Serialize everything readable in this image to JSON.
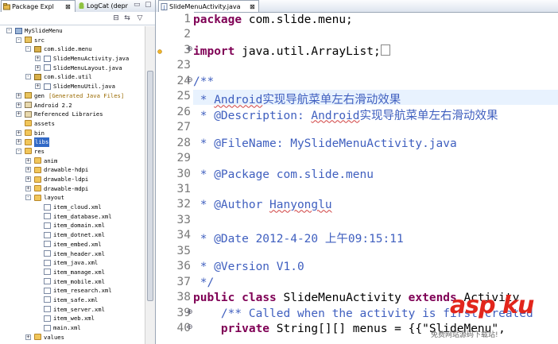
{
  "left_panel": {
    "tabs": [
      {
        "label": "Package Expl",
        "icon": "package-explorer-icon"
      },
      {
        "label": "LogCat (depr",
        "icon": "android-icon"
      }
    ],
    "tree": [
      {
        "label": "MySlideMenu",
        "depth": 0,
        "expander": "-",
        "icon": "project"
      },
      {
        "label": "src",
        "depth": 1,
        "expander": "-",
        "icon": "pkgfolder"
      },
      {
        "label": "com.slide.menu",
        "depth": 2,
        "expander": "-",
        "icon": "package"
      },
      {
        "label": "SlideMenuActivity.java",
        "depth": 3,
        "expander": "+",
        "icon": "javafile"
      },
      {
        "label": "SlideMenuLayout.java",
        "depth": 3,
        "expander": "+",
        "icon": "javafile"
      },
      {
        "label": "com.slide.util",
        "depth": 2,
        "expander": "-",
        "icon": "package"
      },
      {
        "label": "SlideMenuUtil.java",
        "depth": 3,
        "expander": "+",
        "icon": "javafile"
      },
      {
        "label": "gen",
        "suffix": "[Generated Java Files]",
        "depth": 1,
        "expander": "+",
        "icon": "pkgfolder"
      },
      {
        "label": "Android 2.2",
        "depth": 1,
        "expander": "+",
        "icon": "libfolder"
      },
      {
        "label": "Referenced Libraries",
        "depth": 1,
        "expander": "+",
        "icon": "libfolder"
      },
      {
        "label": "assets",
        "depth": 1,
        "expander": "",
        "icon": "folder"
      },
      {
        "label": "bin",
        "depth": 1,
        "expander": "+",
        "icon": "folder"
      },
      {
        "label": "libs",
        "depth": 1,
        "expander": "+",
        "icon": "folder",
        "selected": true
      },
      {
        "label": "res",
        "depth": 1,
        "expander": "-",
        "icon": "folder"
      },
      {
        "label": "anim",
        "depth": 2,
        "expander": "+",
        "icon": "folder"
      },
      {
        "label": "drawable-hdpi",
        "depth": 2,
        "expander": "+",
        "icon": "folder"
      },
      {
        "label": "drawable-ldpi",
        "depth": 2,
        "expander": "+",
        "icon": "folder"
      },
      {
        "label": "drawable-mdpi",
        "depth": 2,
        "expander": "+",
        "icon": "folder"
      },
      {
        "label": "layout",
        "depth": 2,
        "expander": "-",
        "icon": "folder"
      },
      {
        "label": "item_cloud.xml",
        "depth": 3,
        "expander": "",
        "icon": "xmlfile"
      },
      {
        "label": "item_database.xml",
        "depth": 3,
        "expander": "",
        "icon": "xmlfile"
      },
      {
        "label": "item_domain.xml",
        "depth": 3,
        "expander": "",
        "icon": "xmlfile"
      },
      {
        "label": "item_dotnet.xml",
        "depth": 3,
        "expander": "",
        "icon": "xmlfile"
      },
      {
        "label": "item_embed.xml",
        "depth": 3,
        "expander": "",
        "icon": "xmlfile"
      },
      {
        "label": "item_header.xml",
        "depth": 3,
        "expander": "",
        "icon": "xmlfile"
      },
      {
        "label": "item_java.xml",
        "depth": 3,
        "expander": "",
        "icon": "xmlfile"
      },
      {
        "label": "item_manage.xml",
        "depth": 3,
        "expander": "",
        "icon": "xmlfile"
      },
      {
        "label": "item_mobile.xml",
        "depth": 3,
        "expander": "",
        "icon": "xmlfile"
      },
      {
        "label": "item_research.xml",
        "depth": 3,
        "expander": "",
        "icon": "xmlfile"
      },
      {
        "label": "item_safe.xml",
        "depth": 3,
        "expander": "",
        "icon": "xmlfile"
      },
      {
        "label": "item_server.xml",
        "depth": 3,
        "expander": "",
        "icon": "xmlfile"
      },
      {
        "label": "item_web.xml",
        "depth": 3,
        "expander": "",
        "icon": "xmlfile"
      },
      {
        "label": "main.xml",
        "depth": 3,
        "expander": "",
        "icon": "xmlfile"
      },
      {
        "label": "values",
        "depth": 2,
        "expander": "+",
        "icon": "folder"
      }
    ]
  },
  "editor": {
    "tab_label": "SlideMenuActivity.java",
    "tab_close": "⊠",
    "highlight_line": 25,
    "lines": [
      {
        "no": "1",
        "segments": [
          {
            "t": "package",
            "c": "kw"
          },
          {
            "t": " com.slide.menu;"
          }
        ]
      },
      {
        "no": "2",
        "segments": []
      },
      {
        "no": "3",
        "fold": "+",
        "marker": true,
        "segments": [
          {
            "t": "import",
            "c": "kw"
          },
          {
            "t": " java.util.ArrayList;"
          },
          {
            "t": "",
            "c": "foldbox"
          }
        ]
      },
      {
        "no": "23",
        "segments": []
      },
      {
        "no": "24",
        "fold": "-",
        "segments": [
          {
            "t": "/**",
            "c": "cm"
          }
        ]
      },
      {
        "no": "25",
        "segments": [
          {
            "t": " * ",
            "c": "cm"
          },
          {
            "t": "Android",
            "c": "cm squig"
          },
          {
            "t": "实现导航菜单左右滑动效果",
            "c": "cm cjk"
          }
        ]
      },
      {
        "no": "26",
        "segments": [
          {
            "t": " * @Description: ",
            "c": "cm"
          },
          {
            "t": "Android",
            "c": "cm squig"
          },
          {
            "t": "实现导航菜单左右滑动效果",
            "c": "cm cjk"
          }
        ]
      },
      {
        "no": "27",
        "segments": []
      },
      {
        "no": "28",
        "segments": [
          {
            "t": " * @FileName: MySlideMenuActivity.java",
            "c": "cm"
          }
        ]
      },
      {
        "no": "29",
        "segments": []
      },
      {
        "no": "30",
        "segments": [
          {
            "t": " * @Package com.slide.menu",
            "c": "cm"
          }
        ]
      },
      {
        "no": "31",
        "segments": []
      },
      {
        "no": "32",
        "segments": [
          {
            "t": " * @Author ",
            "c": "cm"
          },
          {
            "t": "Hanyonglu",
            "c": "cm squig"
          }
        ]
      },
      {
        "no": "33",
        "segments": []
      },
      {
        "no": "34",
        "segments": [
          {
            "t": " * @Date 2012-4-20 ",
            "c": "cm"
          },
          {
            "t": "上午",
            "c": "cm cjk"
          },
          {
            "t": "09:15:11",
            "c": "cm"
          }
        ]
      },
      {
        "no": "35",
        "segments": []
      },
      {
        "no": "36",
        "segments": [
          {
            "t": " * @Version V1.0",
            "c": "cm"
          }
        ]
      },
      {
        "no": "37",
        "segments": [
          {
            "t": " */",
            "c": "cm"
          }
        ]
      },
      {
        "no": "38",
        "segments": [
          {
            "t": "public",
            "c": "kw"
          },
          {
            "t": " "
          },
          {
            "t": "class",
            "c": "kw"
          },
          {
            "t": " SlideMenuActivity "
          },
          {
            "t": "extends",
            "c": "kw"
          },
          {
            "t": " Activity"
          }
        ]
      },
      {
        "no": "39",
        "fold": "+",
        "segments": [
          {
            "t": "    /** Called when the activity is first created",
            "c": "cm"
          }
        ]
      },
      {
        "no": "40",
        "fold": "-",
        "segments": [
          {
            "t": "    "
          },
          {
            "t": "private",
            "c": "kw"
          },
          {
            "t": " String[][] menus = {{\"SlideMenu\","
          }
        ]
      }
    ]
  },
  "watermark": {
    "brand": "asp ku",
    "sub": "免费网站源码下载站!"
  }
}
